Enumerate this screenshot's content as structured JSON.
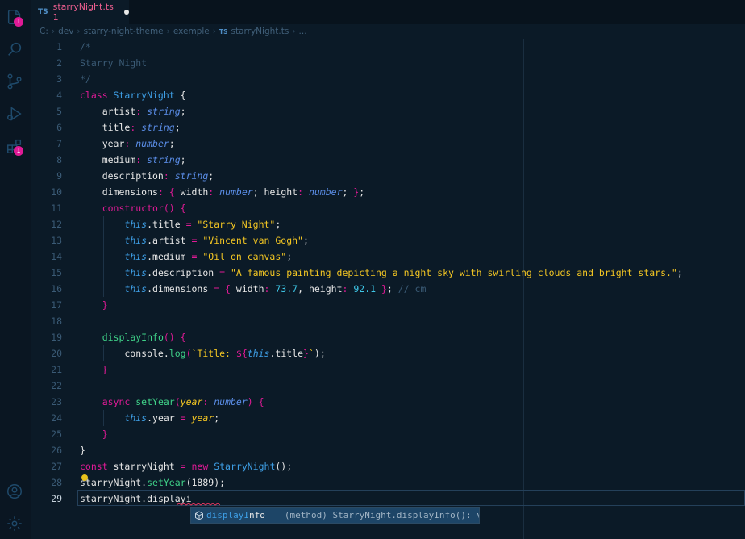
{
  "activity_bar": {
    "explorer_badge": "1",
    "extensions_badge": "1"
  },
  "tab": {
    "lang": "TS",
    "filename": "starryNight.ts",
    "problems": "1"
  },
  "breadcrumb": {
    "parts": [
      "C:",
      "dev",
      "starry-night-theme",
      "exemple"
    ],
    "file_lang": "TS",
    "file": "starryNight.ts",
    "more": "..."
  },
  "colors": {
    "keyword": "#e01a96",
    "class_name": "#3e9fe6",
    "property": "#e6e6e6",
    "type": "#5b8ee8",
    "string": "#f3c623",
    "method": "#3fd188",
    "comment": "#3a5a75",
    "number": "#3ec6e6",
    "this": "#3e9fe6"
  },
  "lines": [
    {
      "n": "1",
      "tokens": [
        [
          "/*",
          "cm"
        ]
      ]
    },
    {
      "n": "2",
      "tokens": [
        [
          "Starry Night",
          "cm"
        ]
      ]
    },
    {
      "n": "3",
      "tokens": [
        [
          "*/",
          "cm"
        ]
      ]
    },
    {
      "n": "4",
      "tokens": [
        [
          "class ",
          "kw"
        ],
        [
          "StarryNight",
          "cls"
        ],
        [
          " {",
          "pl"
        ]
      ]
    },
    {
      "n": "5",
      "tokens": [
        [
          "    artist",
          "pl"
        ],
        [
          ": ",
          "kw"
        ],
        [
          "string",
          "ty"
        ],
        [
          ";",
          "pl"
        ]
      ]
    },
    {
      "n": "6",
      "tokens": [
        [
          "    title",
          "pl"
        ],
        [
          ": ",
          "kw"
        ],
        [
          "string",
          "ty"
        ],
        [
          ";",
          "pl"
        ]
      ]
    },
    {
      "n": "7",
      "tokens": [
        [
          "    year",
          "pl"
        ],
        [
          ": ",
          "kw"
        ],
        [
          "number",
          "ty"
        ],
        [
          ";",
          "pl"
        ]
      ]
    },
    {
      "n": "8",
      "tokens": [
        [
          "    medium",
          "pl"
        ],
        [
          ": ",
          "kw"
        ],
        [
          "string",
          "ty"
        ],
        [
          ";",
          "pl"
        ]
      ]
    },
    {
      "n": "9",
      "tokens": [
        [
          "    description",
          "pl"
        ],
        [
          ": ",
          "kw"
        ],
        [
          "string",
          "ty"
        ],
        [
          ";",
          "pl"
        ]
      ]
    },
    {
      "n": "10",
      "tokens": [
        [
          "    dimensions",
          "pl"
        ],
        [
          ": ",
          "kw"
        ],
        [
          "{ ",
          "kw"
        ],
        [
          "width",
          "pl"
        ],
        [
          ": ",
          "kw"
        ],
        [
          "number",
          "ty"
        ],
        [
          "; ",
          "pl"
        ],
        [
          "height",
          "pl"
        ],
        [
          ": ",
          "kw"
        ],
        [
          "number",
          "ty"
        ],
        [
          "; ",
          "pl"
        ],
        [
          "}",
          "kw"
        ],
        [
          ";",
          "pl"
        ]
      ]
    },
    {
      "n": "11",
      "tokens": [
        [
          "    ",
          "pl"
        ],
        [
          "constructor",
          "kw"
        ],
        [
          "() {",
          "kw"
        ]
      ]
    },
    {
      "n": "12",
      "tokens": [
        [
          "        ",
          "pl"
        ],
        [
          "this",
          "th"
        ],
        [
          ".title ",
          "pl"
        ],
        [
          "= ",
          "kw"
        ],
        [
          "\"Starry Night\"",
          "st"
        ],
        [
          ";",
          "pl"
        ]
      ]
    },
    {
      "n": "13",
      "tokens": [
        [
          "        ",
          "pl"
        ],
        [
          "this",
          "th"
        ],
        [
          ".artist ",
          "pl"
        ],
        [
          "= ",
          "kw"
        ],
        [
          "\"Vincent van Gogh\"",
          "st"
        ],
        [
          ";",
          "pl"
        ]
      ]
    },
    {
      "n": "14",
      "tokens": [
        [
          "        ",
          "pl"
        ],
        [
          "this",
          "th"
        ],
        [
          ".medium ",
          "pl"
        ],
        [
          "= ",
          "kw"
        ],
        [
          "\"Oil on canvas\"",
          "st"
        ],
        [
          ";",
          "pl"
        ]
      ]
    },
    {
      "n": "15",
      "tokens": [
        [
          "        ",
          "pl"
        ],
        [
          "this",
          "th"
        ],
        [
          ".description ",
          "pl"
        ],
        [
          "= ",
          "kw"
        ],
        [
          "\"A famous painting depicting a night sky with swirling clouds and bright stars.\"",
          "st"
        ],
        [
          ";",
          "pl"
        ]
      ]
    },
    {
      "n": "16",
      "tokens": [
        [
          "        ",
          "pl"
        ],
        [
          "this",
          "th"
        ],
        [
          ".dimensions ",
          "pl"
        ],
        [
          "= ",
          "kw"
        ],
        [
          "{ ",
          "kw"
        ],
        [
          "width",
          "pl"
        ],
        [
          ": ",
          "kw"
        ],
        [
          "73.7",
          "nu"
        ],
        [
          ", ",
          "pl"
        ],
        [
          "height",
          "pl"
        ],
        [
          ": ",
          "kw"
        ],
        [
          "92.1",
          "nu"
        ],
        [
          " }",
          "kw"
        ],
        [
          "; ",
          "pl"
        ],
        [
          "// cm",
          "cm"
        ]
      ]
    },
    {
      "n": "17",
      "tokens": [
        [
          "    ",
          "pl"
        ],
        [
          "}",
          "kw"
        ]
      ]
    },
    {
      "n": "18",
      "tokens": []
    },
    {
      "n": "19",
      "tokens": [
        [
          "    ",
          "pl"
        ],
        [
          "displayInfo",
          "me"
        ],
        [
          "() {",
          "kw"
        ]
      ]
    },
    {
      "n": "20",
      "tokens": [
        [
          "        console",
          "pl"
        ],
        [
          ".",
          "pl"
        ],
        [
          "log",
          "me"
        ],
        [
          "(",
          "kw"
        ],
        [
          "`Title: ",
          "st"
        ],
        [
          "${",
          "kw"
        ],
        [
          "this",
          "th"
        ],
        [
          ".title",
          "pl"
        ],
        [
          "}",
          "kw"
        ],
        [
          "`",
          "st"
        ],
        [
          ");",
          "pl"
        ]
      ]
    },
    {
      "n": "21",
      "tokens": [
        [
          "    ",
          "pl"
        ],
        [
          "}",
          "kw"
        ]
      ]
    },
    {
      "n": "22",
      "tokens": []
    },
    {
      "n": "23",
      "tokens": [
        [
          "    ",
          "pl"
        ],
        [
          "async ",
          "kw"
        ],
        [
          "setYear",
          "me"
        ],
        [
          "(",
          "kw"
        ],
        [
          "year",
          "pa"
        ],
        [
          ": ",
          "kw"
        ],
        [
          "number",
          "ty"
        ],
        [
          ") {",
          "kw"
        ]
      ]
    },
    {
      "n": "24",
      "tokens": [
        [
          "        ",
          "pl"
        ],
        [
          "this",
          "th"
        ],
        [
          ".year ",
          "pl"
        ],
        [
          "= ",
          "kw"
        ],
        [
          "year",
          "pa"
        ],
        [
          ";",
          "pl"
        ]
      ]
    },
    {
      "n": "25",
      "tokens": [
        [
          "    ",
          "pl"
        ],
        [
          "}",
          "kw"
        ]
      ]
    },
    {
      "n": "26",
      "tokens": [
        [
          "}",
          "pl"
        ]
      ]
    },
    {
      "n": "27",
      "tokens": [
        [
          "const ",
          "kw"
        ],
        [
          "starryNight ",
          "pl"
        ],
        [
          "= ",
          "kw"
        ],
        [
          "new ",
          "kw"
        ],
        [
          "StarryNight",
          "cls"
        ],
        [
          "();",
          "pl"
        ]
      ]
    },
    {
      "n": "28",
      "tokens": [
        [
          "starryNight",
          "pl"
        ],
        [
          ".",
          "pl"
        ],
        [
          "setYear",
          "me"
        ],
        [
          "(1889);",
          "pl"
        ]
      ]
    },
    {
      "n": "29",
      "tokens": [
        [
          "starryNight",
          "pl"
        ],
        [
          ".",
          "pl"
        ],
        [
          "displayi",
          "pl"
        ]
      ]
    }
  ],
  "suggestion": {
    "match": "displayI",
    "rest": "nfo",
    "detail": "(method) StarryNight.displayInfo(): vo…"
  }
}
